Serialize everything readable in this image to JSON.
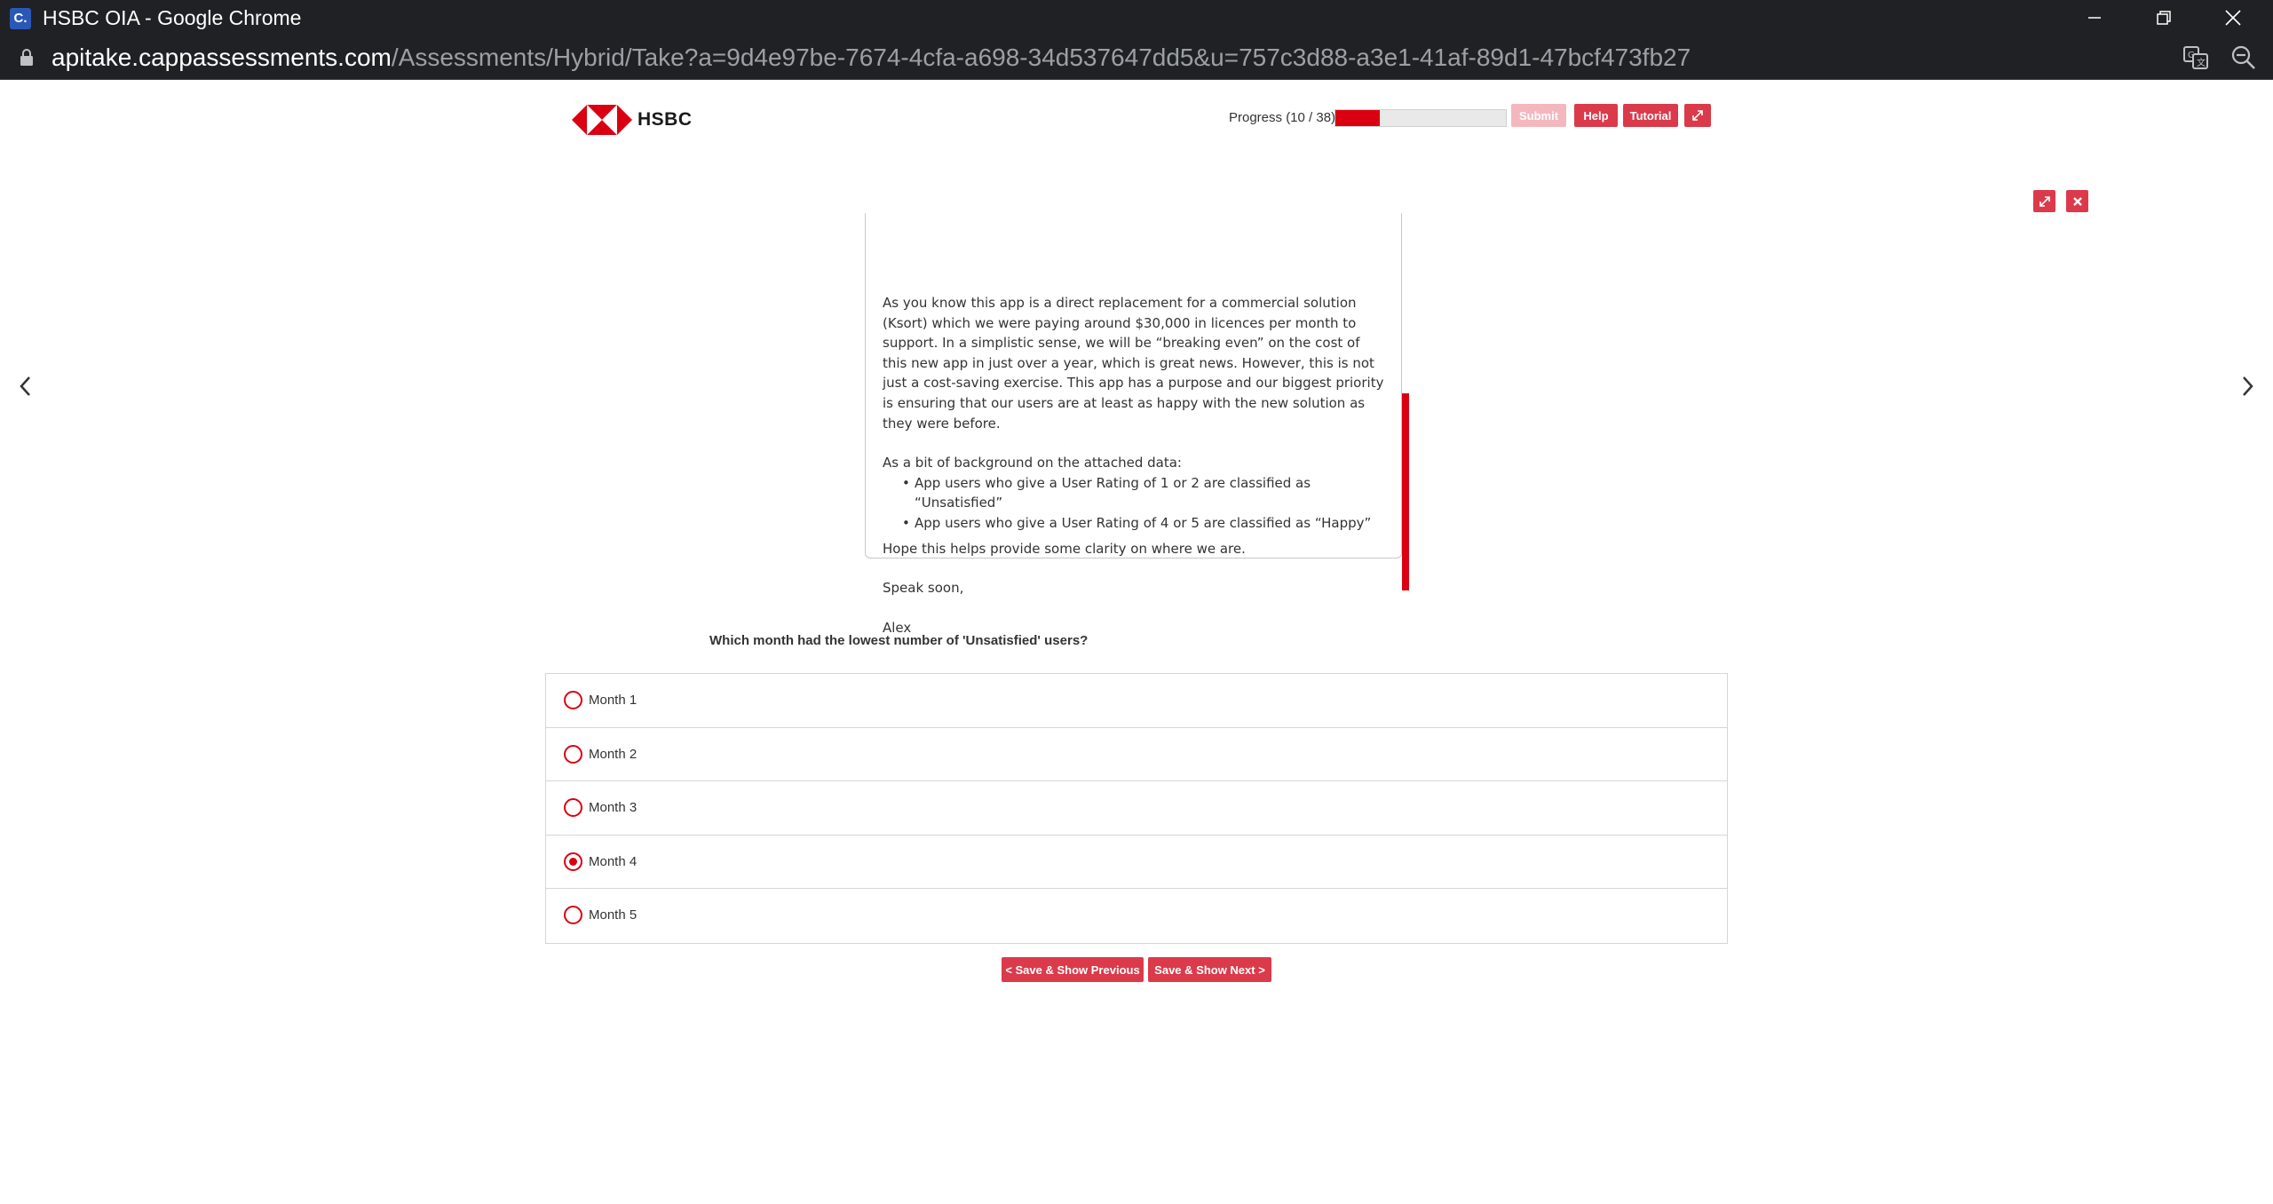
{
  "window": {
    "title": "HSBC OIA - Google Chrome",
    "app_icon_letter": "C."
  },
  "address_bar": {
    "host": "apitake.cappassessments.com",
    "path": "/Assessments/Hybrid/Take?a=9d4e97be-7674-4cfa-a698-34d537647dd5&u=757c3d88-a3e1-41af-89d1-47bcf473fb27"
  },
  "header": {
    "logo_text": "HSBC",
    "progress_label": "Progress (10 / 38)",
    "progress_fraction": 0.263,
    "submit_label": "Submit",
    "help_label": "Help",
    "tutorial_label": "Tutorial"
  },
  "email": {
    "paragraph1": "As you know this app is a direct replacement for a commercial solution (Ksort) which we were paying around $30,000 in licences per month to support. In a simplistic sense, we will be “breaking even” on the cost of this new app in just over a year, which is great news. However, this is not just a cost-saving exercise. This app has a purpose and our biggest priority is ensuring that our users are at least as happy with the new solution as they were before.",
    "background_intro": "As a bit of background on the attached data:",
    "bullets": [
      "App users who give a User Rating of 1 or 2 are classified as “Unsatisfied”",
      "App users who give a User Rating of 4 or 5 are classified as “Happy”"
    ],
    "closing": "Hope this helps provide some clarity on where we are.",
    "signoff": "Speak soon,",
    "signature": "Alex"
  },
  "question": {
    "text": "Which month had the lowest number of 'Unsatisfied' users?",
    "options": [
      {
        "label": "Month 1",
        "selected": false
      },
      {
        "label": "Month 2",
        "selected": false
      },
      {
        "label": "Month 3",
        "selected": false
      },
      {
        "label": "Month 4",
        "selected": true
      },
      {
        "label": "Month 5",
        "selected": false
      }
    ]
  },
  "footer": {
    "prev_label": "< Save & Show Previous",
    "next_label": "Save & Show Next >"
  },
  "colors": {
    "brand_red": "#db0011",
    "button_red": "#db3a4b",
    "disabled_red": "#f3b7be",
    "chrome_dark": "#202124"
  }
}
